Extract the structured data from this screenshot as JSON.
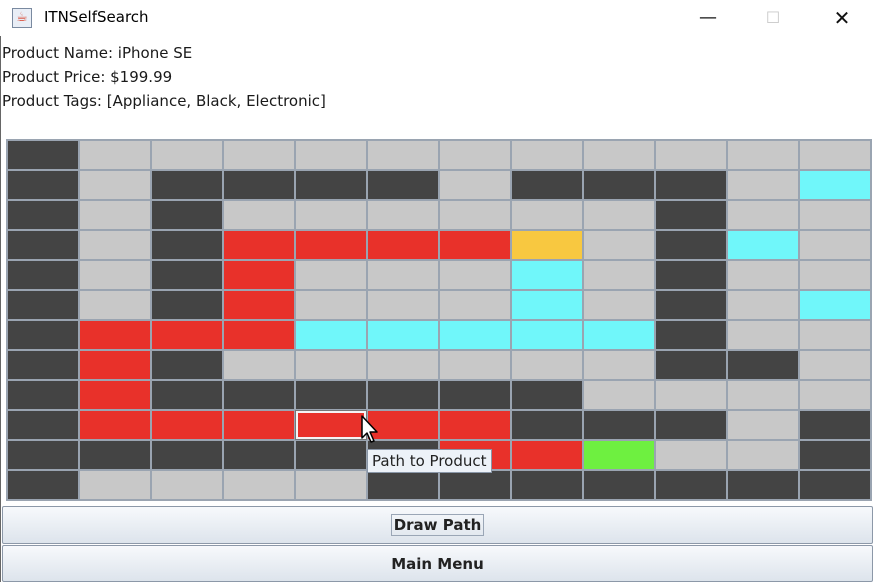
{
  "window": {
    "title": "ITNSelfSearch",
    "minimize_glyph": "—",
    "maximize_glyph": "☐",
    "close_glyph": "✕",
    "icon": "java-cup-icon"
  },
  "product": {
    "name_line": "Product Name: iPhone SE",
    "price_line": "Product Price: $199.99",
    "tags_line": "Product Tags: [Appliance, Black, Electronic]"
  },
  "colors": {
    "D": "#444444",
    "L": "#c8c8c8",
    "R": "#e8312a",
    "C": "#70f7fa",
    "Y": "#f8c840",
    "G": "#6ef040"
  },
  "grid": {
    "rows": 12,
    "cols": 12,
    "selected_cell": [
      9,
      4
    ],
    "cells": [
      "DLLLLLLLLLLL",
      "DLDDDDLDDDLC",
      "DLDLLLLLLDLL",
      "DLDRRRRYLDCL",
      "DLDRLLLCLDLL",
      "DLDRLLLCLDLC",
      "DRRRCCCCCDLL",
      "DRDLLLLLLDDL",
      "DRDDDDDDLLLL",
      "DRRRRRRDDDLD",
      "DDDDDDRRGLLD",
      "DLLLLDDDDDDD"
    ]
  },
  "tooltip": "Path to Product",
  "buttons": {
    "draw_path": "Draw Path",
    "main_menu": "Main Menu"
  }
}
